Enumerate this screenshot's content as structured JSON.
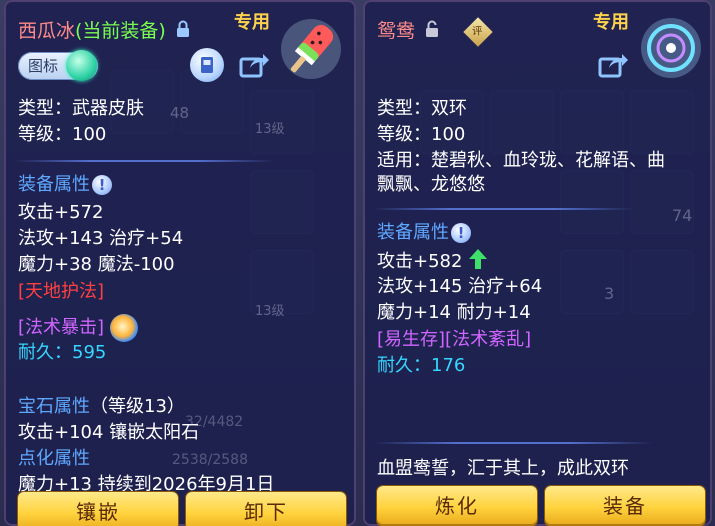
{
  "left_panel": {
    "name": "西瓜冰",
    "status": "(当前装备)",
    "exclusive": "专用",
    "toggle_label": "图标",
    "type_line": "类型：武器皮肤",
    "level_line": "等级：100",
    "equip_attr_header": "装备属性",
    "attr_lines": [
      "攻击+572",
      "法攻+143 治疗+54",
      "魔力+38 魔法-100"
    ],
    "special_1": "[天地护法]",
    "special_2": "[法术暴击]",
    "durability_label": "耐久：",
    "durability_value": "595",
    "gem_header": "宝石属性",
    "gem_level": "（等级13）",
    "gem_line": "攻击+104 镶嵌太阳石",
    "refine_header": "点化属性",
    "refine_line": "魔力+13 持续到2026年9月1日",
    "buttons": {
      "inlay": "镶嵌",
      "remove": "卸下"
    }
  },
  "right_panel": {
    "name": "鸳鸯",
    "badge": "评",
    "exclusive": "专用",
    "type_line": "类型：双环",
    "level_line": "等级：100",
    "applies_line_1": "适用：楚碧秋、血玲珑、花解语、曲",
    "applies_line_2": "飘飘、龙悠悠",
    "equip_attr_header": "装备属性",
    "attr_line_1": "攻击+582",
    "attr_line_2": "法攻+145 治疗+64",
    "attr_line_3": "魔力+14 耐力+14",
    "special": "[易生存][法术紊乱]",
    "durability_label": "耐久：",
    "durability_value": "176",
    "description": "血盟鸯誓，汇于其上，成此双环",
    "buttons": {
      "refine": "炼化",
      "equip": "装备"
    }
  },
  "background": {
    "texts": [
      "48",
      "13级",
      "13级",
      "74",
      "3",
      "32/4482",
      "2538/2588"
    ]
  },
  "colors": {
    "panel_bg": "#1c204e",
    "text_white": "#ffffff",
    "attr_blue": "#5fa8ff",
    "current_green": "#79ff4f",
    "special_red": "#ff4040",
    "special_magenta": "#d065ff",
    "durability_cyan": "#36d6ff",
    "exclusive_gold": "#ffd24d",
    "button_gold": "#ffd23c"
  }
}
